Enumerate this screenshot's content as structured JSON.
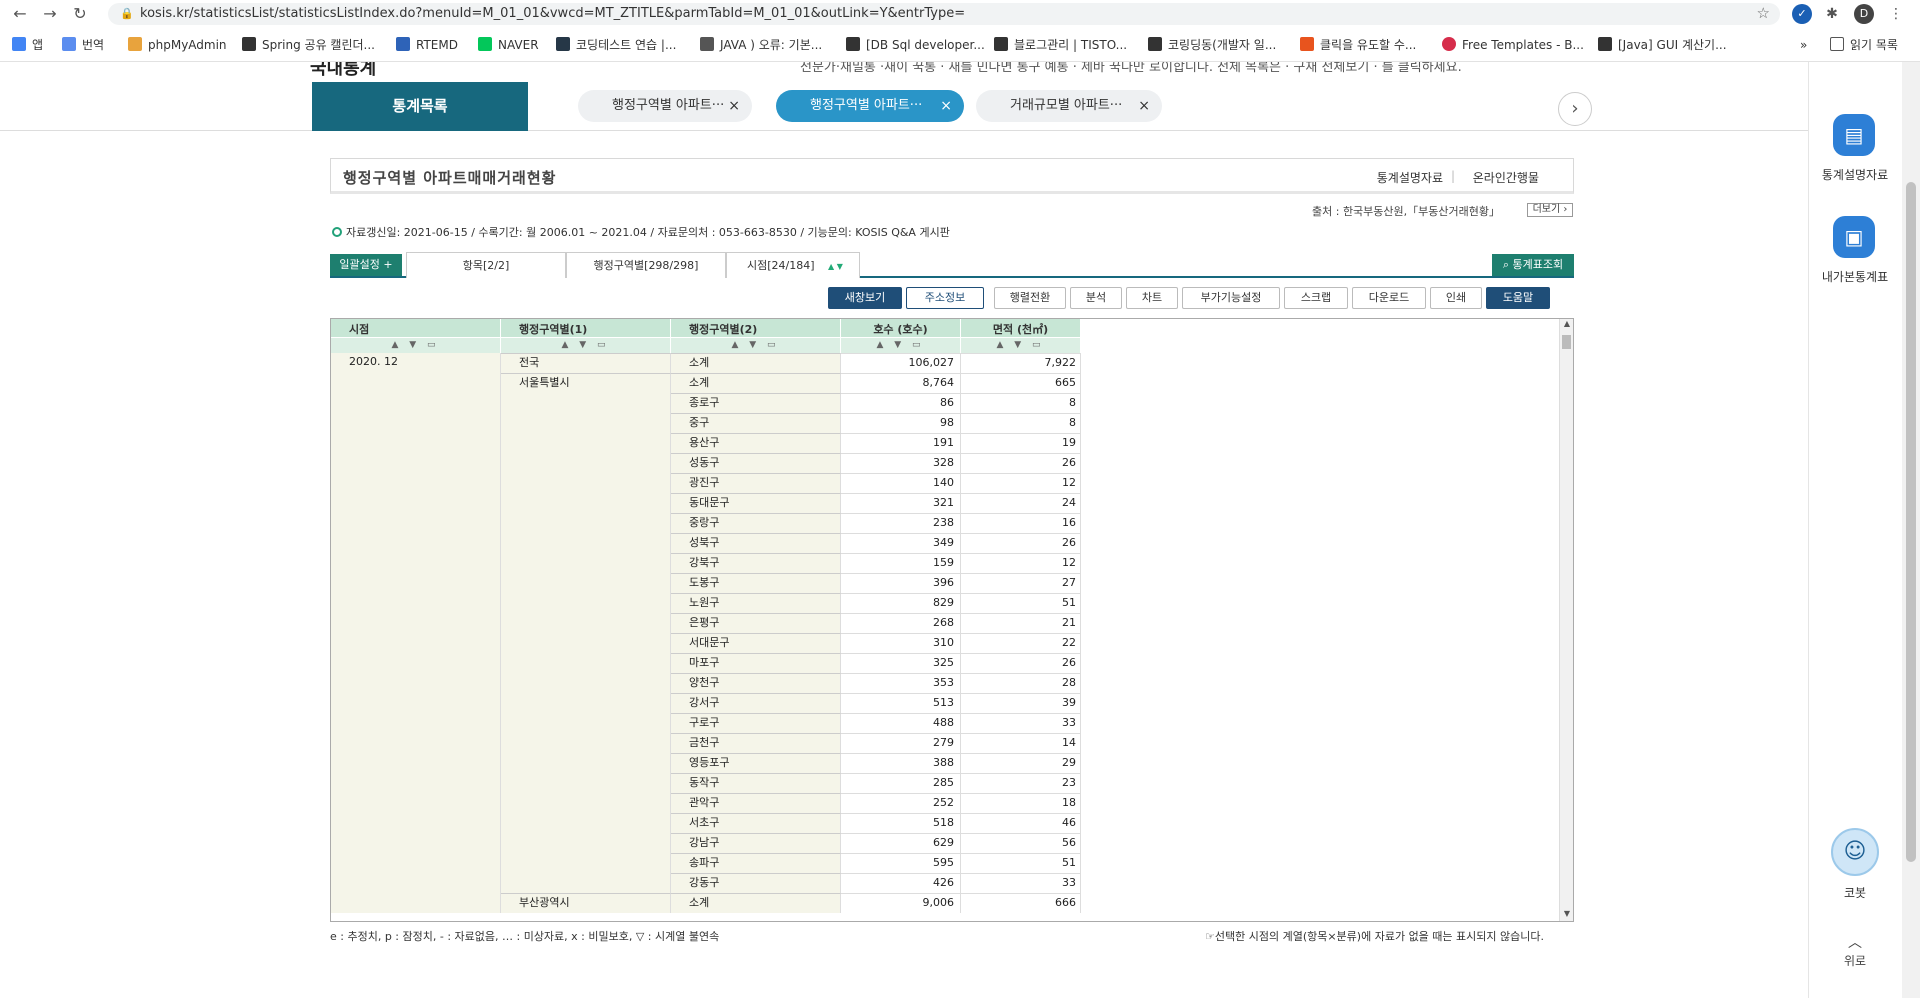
{
  "browser": {
    "url": "kosis.kr/statisticsList/statisticsListIndex.do?menuId=M_01_01&vwcd=MT_ZTITLE&parmTabId=M_01_01&outLink=Y&entrType=",
    "profile_initial": "D",
    "bookmarks": [
      "앱",
      "번역",
      "phpMyAdmin",
      "Spring 공유 캘린더...",
      "RTEMD",
      "NAVER",
      "코딩테스트 연습 |...",
      "JAVA ) 오류: 기본...",
      "[DB Sql developer...",
      "블로그관리 | TISTO...",
      "코링딩동(개발자 일...",
      "클릭을 유도할 수...",
      "Free Templates - B...",
      "[Java] GUI 계산기..."
    ],
    "reading_list": "읽기 목록",
    "more": "»"
  },
  "page": {
    "top_cut_title": "국내통계",
    "top_cut_text": "전문가·재밀통 ·새이 꾹통 · 새를 민다면 통구 예통 · 제바 꾹다만 로이합니다. 전체 목록은 · 구재 전체보기 · 를 클릭하세요.",
    "stat_list_tab": "통계목록",
    "tabs": [
      {
        "label": "행정구역별 아파트···",
        "active": false
      },
      {
        "label": "행정구역별 아파트···",
        "active": true
      },
      {
        "label": "거래규모별 아파트···",
        "active": false
      }
    ],
    "tab_close": "×",
    "tab_next": "›",
    "title": "행정구역별 아파트매매거래현황",
    "title_link1": "통계설명자료",
    "title_sep": "|",
    "title_link2": "온라인간행물",
    "source": "출처 : 한국부동산원,「부동산거래현황」",
    "more_btn": "더보기 ›",
    "info_line": "자료갱신일: 2021-06-15 / 수록기간: 월 2006.01 ~ 2021.04 / 자료문의처 : 053-663-8530 / 기능문의: KOSIS Q&A 게시판",
    "bulk_btn": "일괄설정 +",
    "setting_tabs": [
      "항목[2/2]",
      "행정구역별[298/298]",
      "시점[24/184]"
    ],
    "setting_tab_arrows": "▲ ▼",
    "stat_query_btn": "통계표조회",
    "toolbar": [
      "새창보기",
      "주소정보",
      "행렬전환",
      "분석",
      "차트",
      "부가기능설정",
      "스크랩",
      "다운로드",
      "인쇄",
      "도움말"
    ],
    "legend": "e : 추정치, p : 잠정치, - : 자료없음, … : 미상자료, x : 비밀보호, ▽ : 시계열 불연속",
    "legend_right": "☞선택한 시점의 계열(항목×분류)에 자료가 없을 때는 표시되지 않습니다."
  },
  "grid": {
    "headers": [
      "시점",
      "행정구역별(1)",
      "행정구역별(2)",
      "호수 (호수)",
      "면적 (천㎡)"
    ],
    "header_ctrl": "▲ ▼ ▭",
    "period": "2020. 12",
    "rows": [
      {
        "r1": "전국",
        "r2": "소계",
        "count": "106,027",
        "area": "7,922"
      },
      {
        "r1": "서울특별시",
        "r2": "소계",
        "count": "8,764",
        "area": "665"
      },
      {
        "r1": "",
        "r2": "종로구",
        "count": "86",
        "area": "8"
      },
      {
        "r1": "",
        "r2": "중구",
        "count": "98",
        "area": "8"
      },
      {
        "r1": "",
        "r2": "용산구",
        "count": "191",
        "area": "19"
      },
      {
        "r1": "",
        "r2": "성동구",
        "count": "328",
        "area": "26"
      },
      {
        "r1": "",
        "r2": "광진구",
        "count": "140",
        "area": "12"
      },
      {
        "r1": "",
        "r2": "동대문구",
        "count": "321",
        "area": "24"
      },
      {
        "r1": "",
        "r2": "중랑구",
        "count": "238",
        "area": "16"
      },
      {
        "r1": "",
        "r2": "성북구",
        "count": "349",
        "area": "26"
      },
      {
        "r1": "",
        "r2": "강북구",
        "count": "159",
        "area": "12"
      },
      {
        "r1": "",
        "r2": "도봉구",
        "count": "396",
        "area": "27"
      },
      {
        "r1": "",
        "r2": "노원구",
        "count": "829",
        "area": "51"
      },
      {
        "r1": "",
        "r2": "은평구",
        "count": "268",
        "area": "21"
      },
      {
        "r1": "",
        "r2": "서대문구",
        "count": "310",
        "area": "22"
      },
      {
        "r1": "",
        "r2": "마포구",
        "count": "325",
        "area": "26"
      },
      {
        "r1": "",
        "r2": "양천구",
        "count": "353",
        "area": "28"
      },
      {
        "r1": "",
        "r2": "강서구",
        "count": "513",
        "area": "39"
      },
      {
        "r1": "",
        "r2": "구로구",
        "count": "488",
        "area": "33"
      },
      {
        "r1": "",
        "r2": "금천구",
        "count": "279",
        "area": "14"
      },
      {
        "r1": "",
        "r2": "영등포구",
        "count": "388",
        "area": "29"
      },
      {
        "r1": "",
        "r2": "동작구",
        "count": "285",
        "area": "23"
      },
      {
        "r1": "",
        "r2": "관악구",
        "count": "252",
        "area": "18"
      },
      {
        "r1": "",
        "r2": "서초구",
        "count": "518",
        "area": "46"
      },
      {
        "r1": "",
        "r2": "강남구",
        "count": "629",
        "area": "56"
      },
      {
        "r1": "",
        "r2": "송파구",
        "count": "595",
        "area": "51"
      },
      {
        "r1": "",
        "r2": "강동구",
        "count": "426",
        "area": "33"
      },
      {
        "r1": "부산광역시",
        "r2": "소계",
        "count": "9,006",
        "area": "666"
      }
    ]
  },
  "quick_menu": {
    "item1": "통계설명자료",
    "item2": "내가본통계표",
    "robot": "코봇",
    "up": "위로",
    "up_icon": "︿"
  }
}
